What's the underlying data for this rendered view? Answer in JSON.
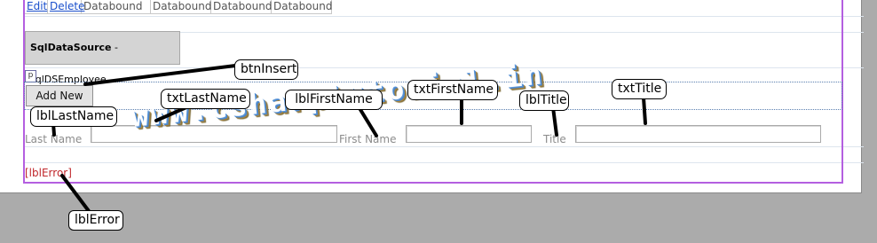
{
  "grid": {
    "edit_link": "Edit",
    "delete_link": "Delete",
    "cells": [
      "Databound",
      "Databound",
      "Databound",
      "Databound"
    ]
  },
  "datasource": {
    "type": "SqlDataSource",
    "separator": " - ",
    "name": "sqlDSEmployee"
  },
  "p_tag": "p",
  "form": {
    "add_button": "Add New",
    "last_name_label": "Last Name",
    "first_name_label": "First Name",
    "title_label": "Title",
    "last_name_value": "",
    "first_name_value": "",
    "title_value": ""
  },
  "error_label": "[lblError]",
  "callouts": {
    "btn_insert": "btnInsert",
    "txt_last_name": "txtLastName",
    "lbl_first_name": "lblFirstName",
    "txt_first_name": "txtFirstName",
    "lbl_title": "lblTitle",
    "txt_title": "txtTitle",
    "lbl_last_name": "lblLastName",
    "lbl_error": "lblError"
  },
  "watermark": "www.csharptutorial.in",
  "colors": {
    "canvas": "#ababab",
    "frame": "#b45fe0",
    "link": "#1a4fcc",
    "error": "#c0282c"
  }
}
